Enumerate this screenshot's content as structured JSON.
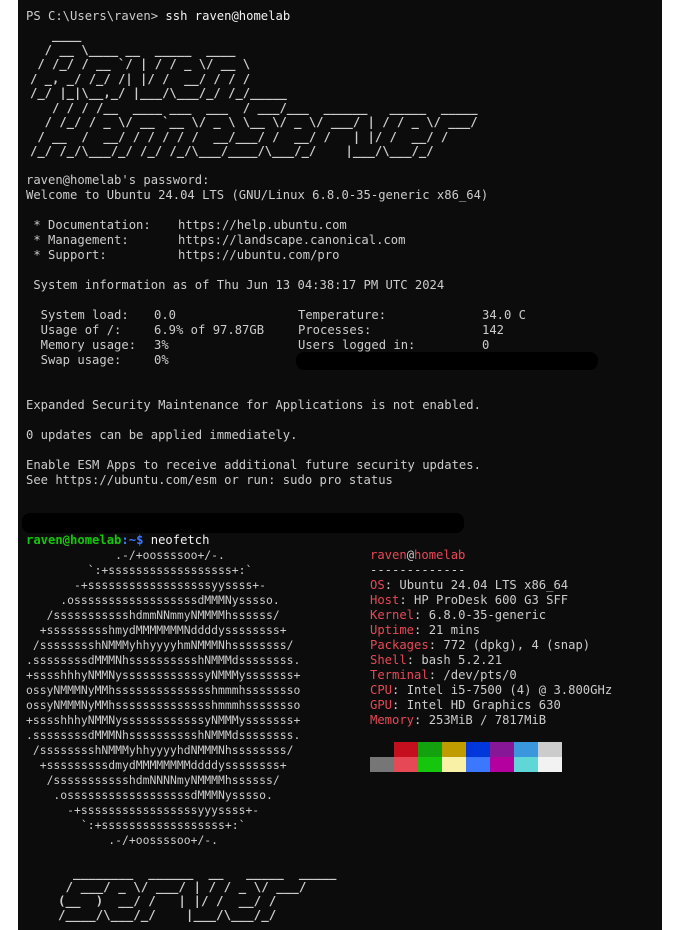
{
  "terminal": {
    "ps_prompt": "PS C:\\Users\\raven> ",
    "ps_command": "ssh raven@homelab",
    "banner_art": "   ____\n  / __ \\____ __  _____  ____\n / /_/ / __ `/ | / / _ \\/ __ \\\n/ _, _/ /_/ /| |/ /  __/ / / /\n/_/ |_|\\__,_/ |___/\\___/_/ /_/_____\n   / / / /__  ____ ___  ___  / ___/___  ______   _____  _____\n  / /_/ / _ \\/ __ `__ \\/ _ \\ \\__ \\/ _ \\/ ___/ | / / _ \\/ ___/\n / __  /  __/ / / / / /  __/___/ /  __/ /   | |/ /  __/ /\n/_/ /_/\\___/_/ /_/ /_/\\___/____/\\___/_/    |___/\\___/_/",
    "password_prompt": "raven@homelab's password:",
    "welcome": "Welcome to Ubuntu 24.04 LTS (GNU/Linux 6.8.0-35-generic x86_64)",
    "links": [
      {
        "label": " * Documentation:",
        "url": "https://help.ubuntu.com"
      },
      {
        "label": " * Management:",
        "url": "https://landscape.canonical.com"
      },
      {
        "label": " * Support:",
        "url": "https://ubuntu.com/pro"
      }
    ],
    "sysinfo_header": " System information as of Thu Jun 13 04:38:17 PM UTC 2024",
    "sysinfo_left": [
      {
        "label": "  System load:",
        "value": "0.0"
      },
      {
        "label": "  Usage of /:",
        "value": "6.9% of 97.87GB"
      },
      {
        "label": "  Memory usage:",
        "value": "3%"
      },
      {
        "label": "  Swap usage:",
        "value": "0%"
      }
    ],
    "sysinfo_right": [
      {
        "label": "Temperature:",
        "value": "34.0 C"
      },
      {
        "label": "Processes:",
        "value": "142"
      },
      {
        "label": "Users logged in:",
        "value": "0"
      }
    ],
    "esm_line": "Expanded Security Maintenance for Applications is not enabled.",
    "updates_line": "0 updates can be applied immediately.",
    "esm_enable_1": "Enable ESM Apps to receive additional future security updates.",
    "esm_enable_2": "See https://ubuntu.com/esm or run: sudo pro status",
    "user_host": "raven@homelab",
    "path": ":~$ ",
    "command": "neofetch"
  },
  "neofetch": {
    "logo": "             .-/+oossssoo+/-.\n         `:+ssssssssssssssssss+:`\n       -+ssssssssssssssssssyyssss+-\n     .ossssssssssssssssssdMMMNysssso.\n   /ssssssssssshdmmNNmmyNMMMMhssssss/\n  +ssssssssshmydMMMMMMMNddddyssssssss+\n /sssssssshNMMMyhhyyyyhmNMMMNhssssssss/\n.ssssssssdMMMNhsssssssssshNMMMdssssssss.\n+sssshhhyNMMNyssssssssssssyNMMMysssssss+\nossyNMMMNyMMhsssssssssssssshmmmhssssssso\nossyNMMMNyMMhsssssssssssssshmmmhssssssso\n+sssshhhyNMMNyssssssssssssyNMMMysssssss+\n.ssssssssdMMMNhsssssssssshNMMMdssssssss.\n /sssssssshNMMMyhhyyyyhdNMMMNhssssssss/\n  +sssssssssdmydMMMMMMMMddddyssssssss+\n   /ssssssssssshdmNNNNmyNMMMMhssssss/\n    .ossssssssssssssssssdMMMNysssso.\n      -+sssssssssssssssssyyyssss+-\n        `:+ssssssssssssssssss+:`\n            .-/+oossssoo+/-.",
    "server_art": "  ________  ______  __   _____  _____\n / ___/ _ \\/ ___/ | / / _ \\/ ___/\n(__  )  __/ /   | |/ /  __/ /\n/____/\\___/_/    |___/\\___/_/",
    "user": "raven",
    "at": "@",
    "host": "homelab",
    "separator": "-------------",
    "fields": [
      {
        "key": "OS",
        "value": "Ubuntu 24.04 LTS x86_64"
      },
      {
        "key": "Host",
        "value": "HP ProDesk 600 G3 SFF"
      },
      {
        "key": "Kernel",
        "value": "6.8.0-35-generic"
      },
      {
        "key": "Uptime",
        "value": "21 mins"
      },
      {
        "key": "Packages",
        "value": "772 (dpkg), 4 (snap)"
      },
      {
        "key": "Shell",
        "value": "bash 5.2.21"
      },
      {
        "key": "Terminal",
        "value": "/dev/pts/0"
      },
      {
        "key": "CPU",
        "value": "Intel i5-7500 (4) @ 3.800GHz"
      },
      {
        "key": "GPU",
        "value": "Intel HD Graphics 630"
      },
      {
        "key": "Memory",
        "value": "253MiB / 7817MiB"
      }
    ],
    "palette_top": [
      "#0c0c0c",
      "#c50f1f",
      "#13a10e",
      "#c19c00",
      "#0037da",
      "#881798",
      "#3a96dd",
      "#cccccc"
    ],
    "palette_bottom": [
      "#767676",
      "#e74856",
      "#16c60c",
      "#f9f1a5",
      "#3b78ff",
      "#b4009e",
      "#61d6d6",
      "#f2f2f2"
    ]
  },
  "colors": {
    "background": "#0c0c0c",
    "foreground": "#cccccc",
    "prompt_user": "#16c60c",
    "prompt_path": "#3b78ff",
    "accent_red": "#e74856"
  }
}
